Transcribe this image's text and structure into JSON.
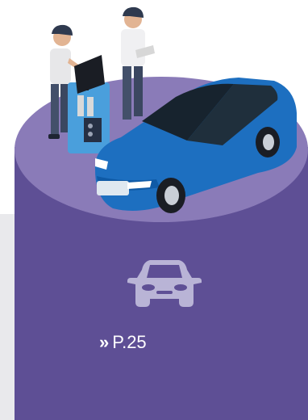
{
  "page_ref": {
    "label": "P.25",
    "arrow": "»"
  },
  "icons": {
    "car": "car-icon",
    "chevron": "double-chevron-right-icon"
  },
  "colors": {
    "pillar": "#5e4f95",
    "top": "#8a7bb8",
    "car_blue": "#1d6fc0",
    "icon": "#b9b4d6"
  }
}
